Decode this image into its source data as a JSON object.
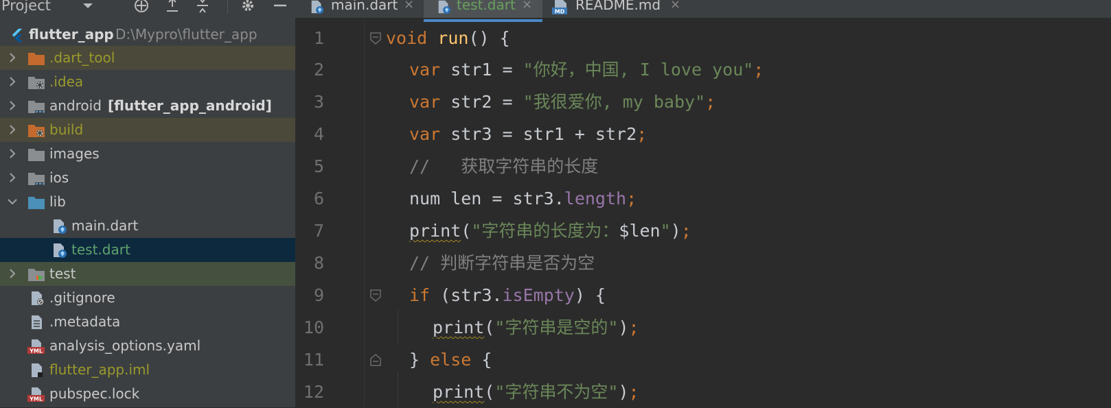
{
  "project_panel": {
    "title": "Project",
    "root": {
      "name": "flutter_app",
      "path": "D:\\Mypro\\flutter_app"
    },
    "items": [
      {
        "label": ".dart_tool",
        "icon": "orange-folder-icon",
        "expandable": true
      },
      {
        "label": ".idea",
        "icon": "settings-folder-icon",
        "expandable": true
      },
      {
        "label": "android",
        "suffix": "[flutter_app_android]",
        "icon": "module-folder-icon",
        "expandable": true
      },
      {
        "label": "build",
        "icon": "excluded-folder-icon",
        "expandable": true
      },
      {
        "label": "images",
        "icon": "folder-icon",
        "expandable": true
      },
      {
        "label": "ios",
        "icon": "module-folder-icon",
        "expandable": true
      },
      {
        "label": "lib",
        "icon": "source-folder-icon",
        "expanded": true
      },
      {
        "label": "main.dart",
        "icon": "dart-file-icon"
      },
      {
        "label": "test.dart",
        "icon": "dart-file-icon",
        "selected": true
      },
      {
        "label": "test",
        "icon": "test-folder-icon",
        "expandable": true
      },
      {
        "label": ".gitignore",
        "icon": "ignore-file-icon"
      },
      {
        "label": ".metadata",
        "icon": "text-file-icon"
      },
      {
        "label": "analysis_options.yaml",
        "icon": "yaml-file-icon"
      },
      {
        "label": "flutter_app.iml",
        "icon": "iml-file-icon"
      },
      {
        "label": "pubspec.lock",
        "icon": "yaml-file-icon"
      }
    ]
  },
  "tabs": [
    {
      "label": "main.dart",
      "icon": "dart-file-icon",
      "close": "×"
    },
    {
      "label": "test.dart",
      "icon": "dart-file-icon",
      "close": "×",
      "active": true
    },
    {
      "label": "README.md",
      "icon": "markdown-file-icon",
      "close": "×"
    }
  ],
  "editor": {
    "line_numbers": [
      "1",
      "2",
      "3",
      "4",
      "5",
      "6",
      "7",
      "8",
      "9",
      "10",
      "11",
      "12"
    ],
    "lines": [
      "void run() {",
      "  var str1 = \"你好，中国, I love you\";",
      "  var str2 = \"我很爱你, my baby\";",
      "  var str3 = str1 + str2;",
      "  //   获取字符串的长度",
      "  num len = str3.length;",
      "  print(\"字符串的长度为：$len\");",
      "  // 判断字符串是否为空",
      "  if (str3.isEmpty) {",
      "    print(\"字符串是空的\");",
      "  } else {",
      "    print(\"字符串不为空\");"
    ]
  },
  "colors": {
    "keyword": "#cc7832",
    "function": "#ffc66d",
    "string": "#6a8759",
    "comment": "#808080",
    "property": "#9876aa",
    "panel_bg": "#3c3f41",
    "editor_bg": "#2b2b2b",
    "selection": "#0d293e"
  }
}
